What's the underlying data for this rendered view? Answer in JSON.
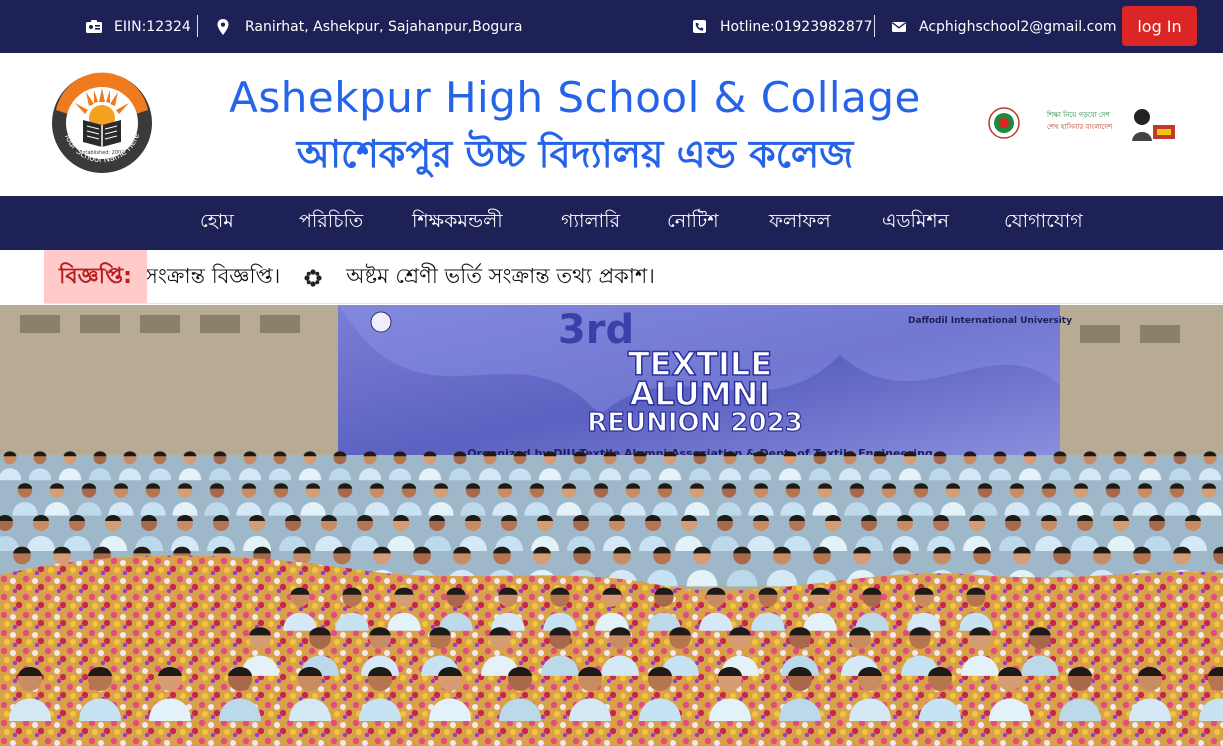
{
  "topbar": {
    "eiin": "EIIN:12324",
    "address": "Ranirhat, Ashekpur, Sajahanpur,Bogura",
    "hotline": "Hotline:01923982877",
    "email": "Acphighschool2@gmail.com",
    "login_label": "log In",
    "icons": [
      "id-card-icon",
      "map-pin-icon",
      "phone-icon",
      "envelope-icon"
    ]
  },
  "header": {
    "title_en": "Ashekpur High School & Collage",
    "title_bn": "আশেকপুর উচ্চ বিদ্যালয় এন্ড কলেজ",
    "logo": {
      "text_ring": "Your School Name Here",
      "established": "Established: 2000"
    },
    "right_logos": {
      "line1": "শিক্ষা নিয়ে গড়বো দেশ",
      "line2": "শেখ হাসিনার বাংলাদেশ"
    }
  },
  "nav": {
    "items": [
      {
        "label": "হোম"
      },
      {
        "label": "পরিচিতি"
      },
      {
        "label": "শিক্ষকমন্ডলী"
      },
      {
        "label": "গ্যালারি"
      },
      {
        "label": "নোটিশ"
      },
      {
        "label": "ফলাফল"
      },
      {
        "label": "এডমিশন"
      },
      {
        "label": "যোগাযোগ"
      }
    ]
  },
  "notice": {
    "label": "বিজ্ঞপ্তি:",
    "items": [
      "সংক্রান্ত বিজ্ঞপ্তি।",
      "অষ্টম শ্রেণী ভর্তি সংক্রান্ত তথ্য প্রকাশ।"
    ]
  },
  "hero": {
    "banner_line1": "3rd",
    "banner_line2": "TEXTILE",
    "banner_line3": "ALUMNI",
    "banner_line4": "REUNION 2023",
    "banner_sub": "Organized by DIU Textile Alumni Association & Dept. of Textile Engineering",
    "banner_brand": "Daffodil International University",
    "colors": {
      "banner": "#6d72c9",
      "shirts": "#cfe6f3",
      "flowers": "#e35a8a"
    }
  },
  "colors": {
    "navy": "#1e2156",
    "accent_blue": "#2563eb",
    "login_red": "#dc2626",
    "notice_label_bg": "#fecaca"
  }
}
